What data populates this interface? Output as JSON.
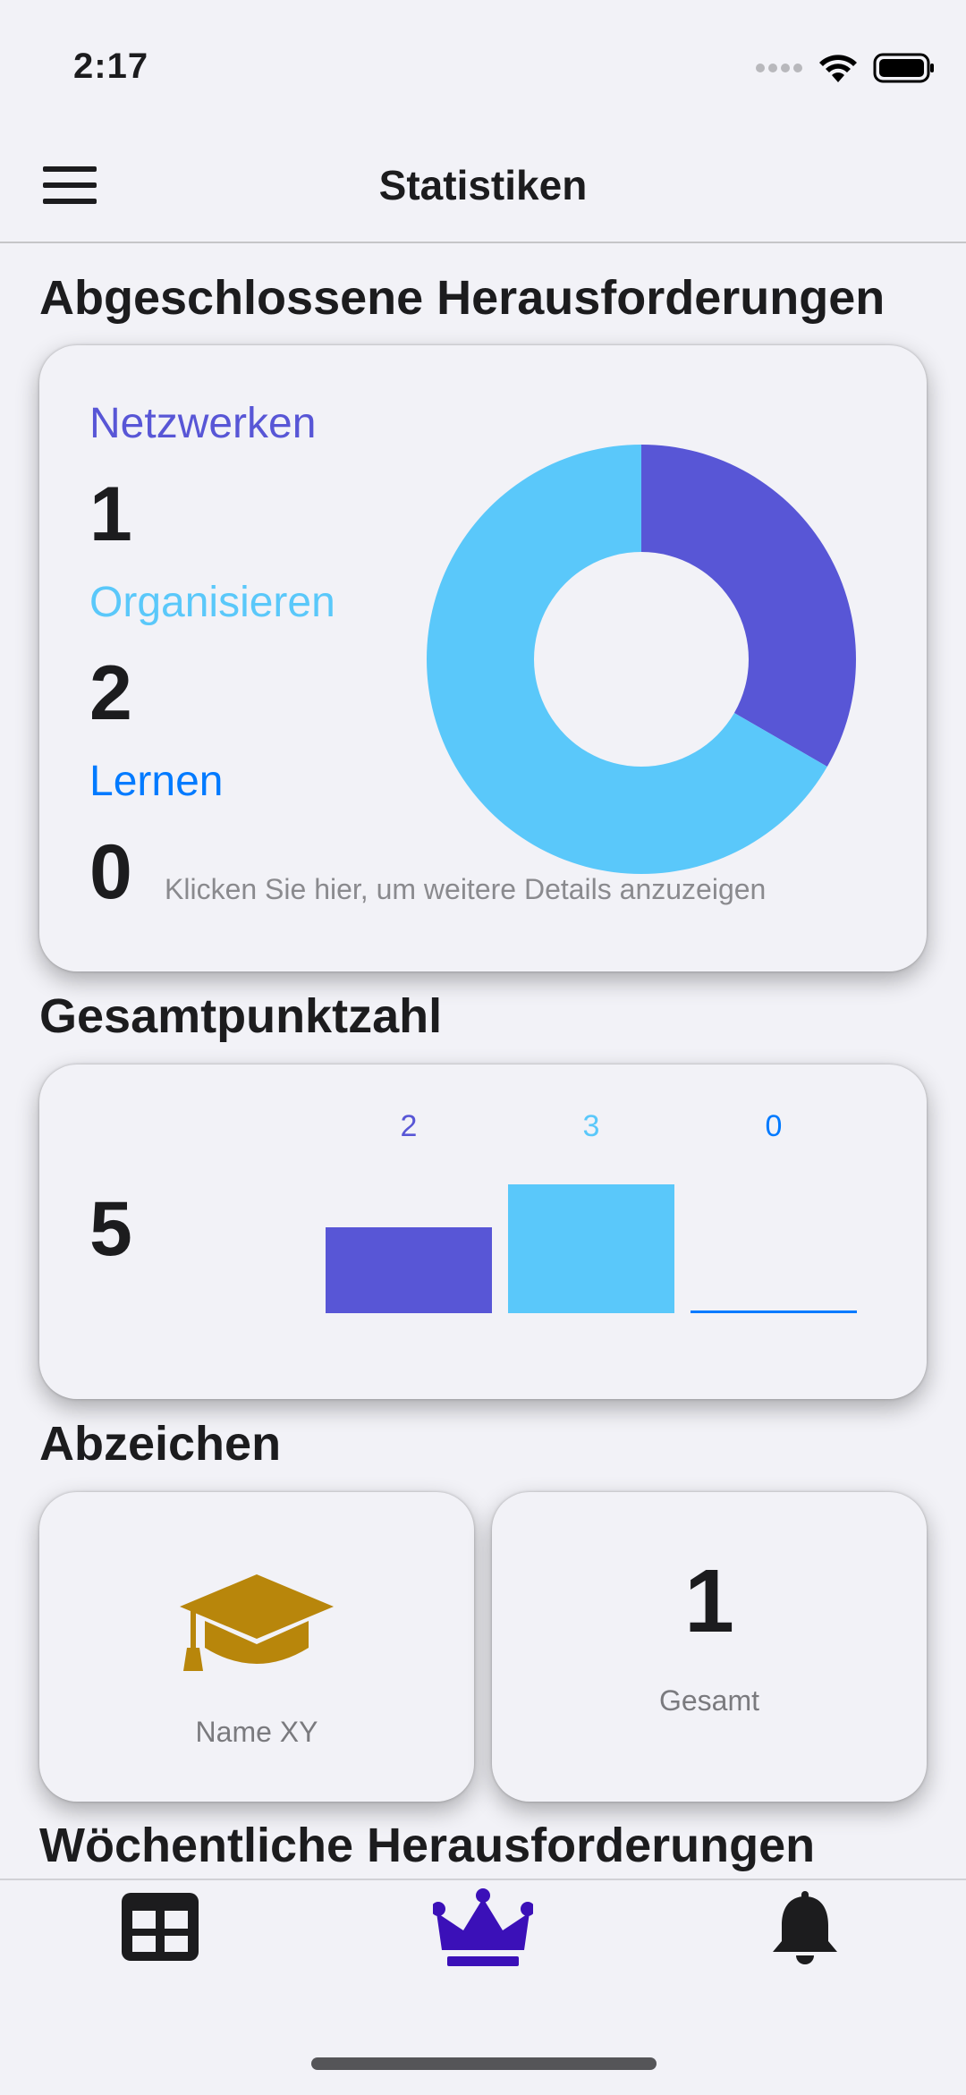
{
  "status": {
    "time": "2:17"
  },
  "nav": {
    "title": "Statistiken"
  },
  "sections": {
    "completed": "Abgeschlossene Herausforderungen",
    "score": "Gesamtpunktzahl",
    "badges": "Abzeichen",
    "weekly": "Wöchentliche Herausforderungen"
  },
  "categories": [
    {
      "label": "Netzwerken",
      "count": "1",
      "color": "#5856d6"
    },
    {
      "label": "Organisieren",
      "count": "2",
      "color": "#5ac8fa"
    },
    {
      "label": "Lernen",
      "count": "0",
      "color": "#007aff"
    }
  ],
  "details_link": "Klicken Sie hier, um weitere Details anzuzeigen",
  "score": {
    "total": "5",
    "bar_labels": [
      "2",
      "3",
      "0"
    ]
  },
  "badges": {
    "badge_name": "Name XY",
    "total_value": "1",
    "total_label": "Gesamt",
    "badge_color": "#b8860b"
  },
  "tabs": [
    {
      "icon": "grid-icon",
      "active": false
    },
    {
      "icon": "crown-icon",
      "active": true
    },
    {
      "icon": "bell-icon",
      "active": false
    }
  ],
  "colors": {
    "accent_purple": "#3b10b8",
    "background": "#f2f2f7"
  },
  "chart_data": [
    {
      "type": "pie",
      "title": "",
      "categories": [
        "Netzwerken",
        "Organisieren",
        "Lernen"
      ],
      "values": [
        1,
        2,
        0
      ],
      "colors": [
        "#5856d6",
        "#5ac8fa",
        "#007aff"
      ],
      "donut": true
    },
    {
      "type": "bar",
      "title": "",
      "categories": [
        "Netzwerken",
        "Organisieren",
        "Lernen"
      ],
      "values": [
        2,
        3,
        0
      ],
      "colors": [
        "#5856d6",
        "#5ac8fa",
        "#007aff"
      ],
      "ylim": [
        0,
        3
      ]
    }
  ]
}
